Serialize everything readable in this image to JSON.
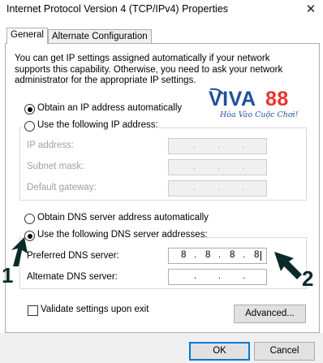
{
  "window": {
    "title": "Internet Protocol Version 4 (TCP/IPv4) Properties",
    "close_glyph": "✕"
  },
  "tabs": [
    {
      "label": "General"
    },
    {
      "label": "Alternate Configuration"
    }
  ],
  "description": "You can get IP settings assigned automatically if your network supports this capability. Otherwise, you need to ask your network administrator for the appropriate IP settings.",
  "ip": {
    "auto_label": "Obtain an IP address automatically",
    "manual_label": "Use the following IP address:",
    "fields": [
      {
        "label": "IP address:",
        "value": "",
        "dots": [
          ".",
          ".",
          "."
        ]
      },
      {
        "label": "Subnet mask:",
        "value": "",
        "dots": [
          ".",
          ".",
          "."
        ]
      },
      {
        "label": "Default gateway:",
        "value": "",
        "dots": [
          ".",
          ".",
          "."
        ]
      }
    ]
  },
  "dns": {
    "auto_label": "Obtain DNS server address automatically",
    "manual_label": "Use the following DNS server addresses:",
    "preferred_label": "Preferred DNS server:",
    "preferred_octets": [
      "8",
      "8",
      "8",
      "8"
    ],
    "alternate_label": "Alternate DNS server:",
    "alternate_dots": [
      ".",
      ".",
      "."
    ]
  },
  "validate_label": "Validate settings upon exit",
  "buttons": {
    "advanced": "Advanced...",
    "ok": "OK",
    "cancel": "Cancel"
  },
  "logo": {
    "part1": "VIVA",
    "part2": "88",
    "slogan": "Hòa Vào Cuộc Chơi!"
  },
  "markers": {
    "first": "1",
    "second": "2"
  },
  "colors": {
    "logo_blue": "#1f4e9c",
    "logo_red": "#e8352c",
    "primary_border": "#0078d7"
  }
}
